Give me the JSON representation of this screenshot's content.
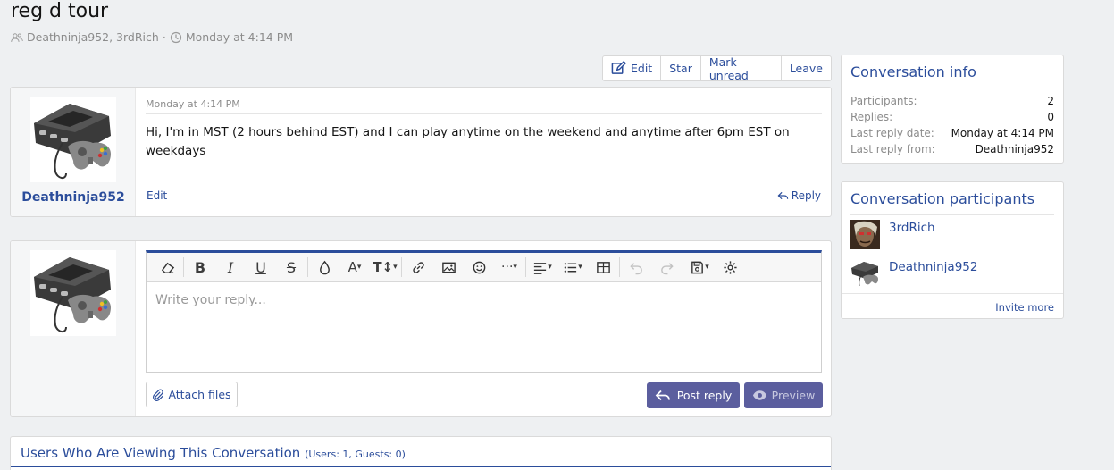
{
  "thread": {
    "title": "reg d tour",
    "participants_text": "Deathninja952, 3rdRich",
    "sep": "·",
    "date_text": "Monday at 4:14 PM"
  },
  "actions": {
    "edit": "Edit",
    "star": "Star",
    "mark_unread": "Mark unread",
    "leave": "Leave"
  },
  "message": {
    "author": "Deathninja952",
    "date": "Monday at 4:14 PM",
    "body": "Hi, I'm in MST (2 hours behind EST) and I can play anytime on the weekend and anytime after 6pm EST on weekdays",
    "edit_label": "Edit",
    "reply_label": "Reply"
  },
  "editor": {
    "placeholder": "Write your reply...",
    "attach_label": "Attach files",
    "post_label": "Post reply",
    "preview_label": "Preview",
    "toolbar_icons": [
      "eraser-icon",
      "bold-icon",
      "italic-icon",
      "underline-icon",
      "strikethrough-icon",
      "text-color-icon",
      "font-family-icon",
      "font-size-icon",
      "link-icon",
      "image-icon",
      "smilie-icon",
      "more-icon",
      "align-icon",
      "list-icon",
      "table-icon",
      "undo-icon",
      "redo-icon",
      "drafts-icon",
      "settings-icon"
    ]
  },
  "viewing": {
    "title": "Users Who Are Viewing This Conversation",
    "counts": "(Users: 1, Guests: 0)"
  },
  "info": {
    "title": "Conversation info",
    "rows": [
      {
        "k": "Participants:",
        "v": "2"
      },
      {
        "k": "Replies:",
        "v": "0"
      },
      {
        "k": "Last reply date:",
        "v": "Monday at 4:14 PM"
      },
      {
        "k": "Last reply from:",
        "v": "Deathninja952"
      }
    ]
  },
  "participants": {
    "title": "Conversation participants",
    "list": [
      "3rdRich",
      "Deathninja952"
    ],
    "invite": "Invite more"
  },
  "colors": {
    "accent": "#2b4d9b",
    "button": "#5b5e9e",
    "page_bg": "#eef0f2"
  }
}
